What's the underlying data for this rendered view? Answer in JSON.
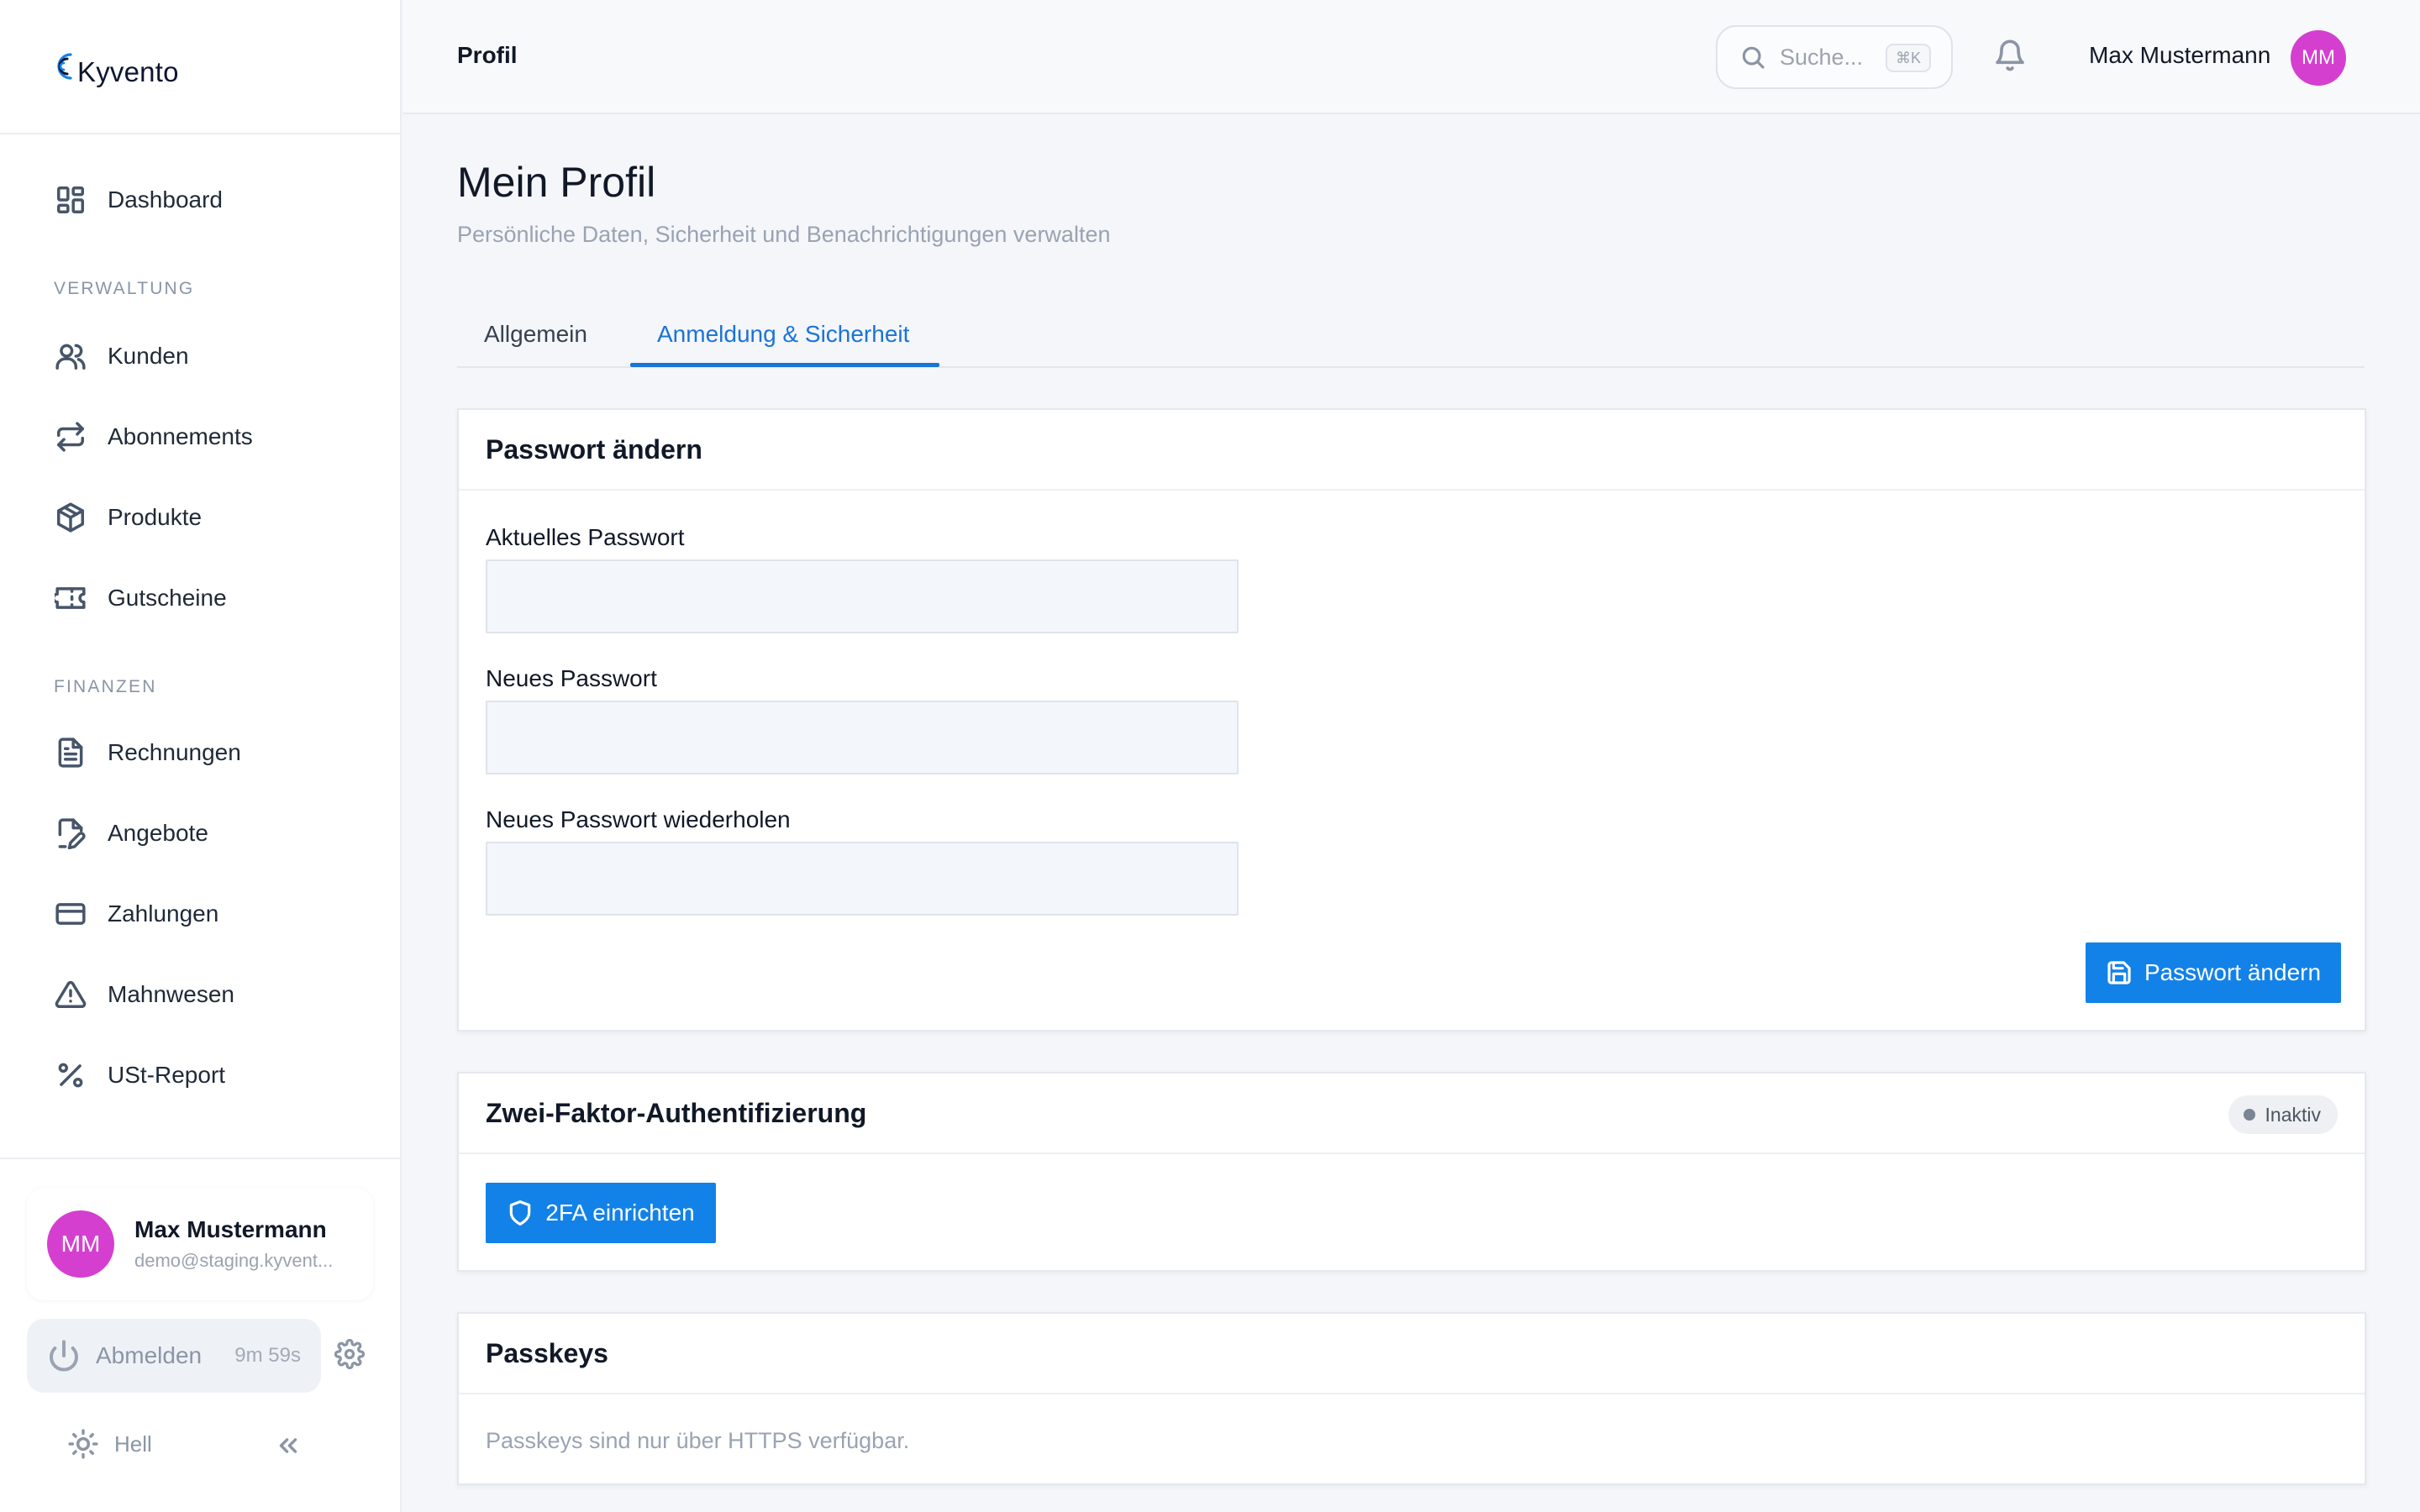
{
  "brand": {
    "name": "Kyvento",
    "accent": "#1282e8",
    "avatar_color": "#d53fd0"
  },
  "sidebar": {
    "items": [
      {
        "label": "Dashboard",
        "icon": "dashboard-icon"
      },
      {
        "label": "Kunden",
        "icon": "users-icon"
      },
      {
        "label": "Abonnements",
        "icon": "repeat-icon"
      },
      {
        "label": "Produkte",
        "icon": "box-icon"
      },
      {
        "label": "Gutscheine",
        "icon": "ticket-icon"
      },
      {
        "label": "Rechnungen",
        "icon": "file-text-icon"
      },
      {
        "label": "Angebote",
        "icon": "file-edit-icon"
      },
      {
        "label": "Zahlungen",
        "icon": "credit-card-icon"
      },
      {
        "label": "Mahnwesen",
        "icon": "alert-triangle-icon"
      },
      {
        "label": "USt-Report",
        "icon": "percent-icon"
      }
    ],
    "sections": {
      "verwaltung": "VERWALTUNG",
      "finanzen": "FINANZEN"
    },
    "user": {
      "initials": "MM",
      "name": "Max Mustermann",
      "email": "demo@staging.kyvent..."
    },
    "logout": {
      "label": "Abmelden",
      "timer": "9m 59s"
    },
    "theme": {
      "label": "Hell"
    }
  },
  "header": {
    "title": "Profil",
    "search": {
      "placeholder": "Suche...",
      "shortcut": "⌘K"
    },
    "user_name": "Max Mustermann",
    "user_initials": "MM"
  },
  "page": {
    "title": "Mein Profil",
    "subtitle": "Persönliche Daten, Sicherheit und Benachrichtigungen verwalten",
    "tabs": [
      {
        "label": "Allgemein",
        "active": false
      },
      {
        "label": "Anmeldung & Sicherheit",
        "active": true
      }
    ]
  },
  "password_card": {
    "title": "Passwort ändern",
    "current_label": "Aktuelles Passwort",
    "new_label": "Neues Passwort",
    "repeat_label": "Neues Passwort wiederholen",
    "current_value": "",
    "new_value": "",
    "repeat_value": "",
    "submit_label": "Passwort ändern"
  },
  "twofa_card": {
    "title": "Zwei-Faktor-Authentifizierung",
    "status": "Inaktiv",
    "button_label": "2FA einrichten"
  },
  "passkeys_card": {
    "title": "Passkeys",
    "note": "Passkeys sind nur über HTTPS verfügbar."
  }
}
